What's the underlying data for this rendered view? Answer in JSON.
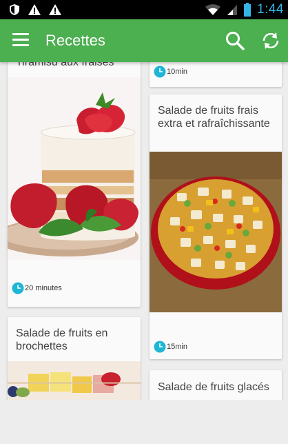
{
  "status_bar": {
    "time": "1:44",
    "icons": [
      "shield-icon",
      "warning-icon",
      "warning-icon",
      "wifi-icon",
      "signal-icon",
      "battery-icon"
    ]
  },
  "toolbar": {
    "title": "Recettes",
    "menu_icon": "hamburger-menu-icon",
    "search_icon": "search-icon",
    "sync_icon": "sync-icon"
  },
  "colors": {
    "toolbar": "#4caf50",
    "clock": "#1eb5d6",
    "time_text": "#33b5e5"
  },
  "recipes": {
    "left": [
      {
        "title": "Tiramisu aux fraises",
        "time": "20 minutes"
      },
      {
        "title": "Salade de fruits en brochettes",
        "time": ""
      }
    ],
    "right": [
      {
        "title": "",
        "time": "10min"
      },
      {
        "title": "Salade de fruits frais extra et rafraîchissante",
        "time": "15min"
      },
      {
        "title": "Salade de fruits glacés",
        "time": ""
      }
    ]
  }
}
